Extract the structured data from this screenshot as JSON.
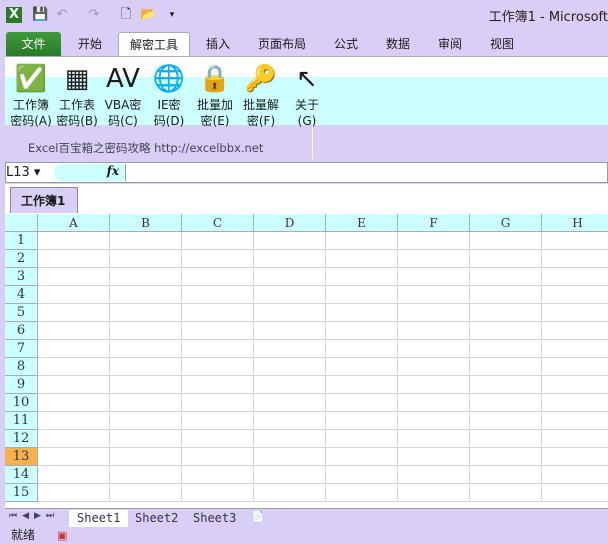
{
  "window": {
    "title": "工作簿1 - Microsoft"
  },
  "quick_access": [
    "excel-icon",
    "save-icon",
    "undo-icon",
    "redo-icon",
    "new-icon",
    "open-icon",
    "customize-icon"
  ],
  "tabs": [
    {
      "label": "文件"
    },
    {
      "label": "开始"
    },
    {
      "label": "解密工具"
    },
    {
      "label": "插入"
    },
    {
      "label": "页面布局"
    },
    {
      "label": "公式"
    },
    {
      "label": "数据"
    },
    {
      "label": "审阅"
    },
    {
      "label": "视图"
    }
  ],
  "ribbon": {
    "buttons": [
      {
        "line1": "工作簿",
        "line2": "密码(A)",
        "icon": "✅"
      },
      {
        "line1": "工作表",
        "line2": "密码(B)",
        "icon": "▦"
      },
      {
        "line1": "VBA密",
        "line2": "码(C)",
        "icon": "AV"
      },
      {
        "line1": "IE密",
        "line2": "码(D)",
        "icon": "🌐"
      },
      {
        "line1": "批量加",
        "line2": "密(E)",
        "icon": "🔒"
      },
      {
        "line1": "批量解",
        "line2": "密(F)",
        "icon": "🔑"
      },
      {
        "line1": "关于",
        "line2": "(G)",
        "icon": "↖"
      }
    ],
    "group_label": "Excel百宝箱之密码攻略  http://excelbbx.net"
  },
  "formula_bar": {
    "name_box": "L13",
    "fx": "fx",
    "value": ""
  },
  "workbook_tab": "工作簿1",
  "columns": [
    "A",
    "B",
    "C",
    "D",
    "E",
    "F",
    "G",
    "H"
  ],
  "rows": [
    "1",
    "2",
    "3",
    "4",
    "5",
    "6",
    "7",
    "8",
    "9",
    "10",
    "11",
    "12",
    "13",
    "14",
    "15"
  ],
  "selected_row": "13",
  "sheets": [
    "Sheet1",
    "Sheet2",
    "Sheet3"
  ],
  "active_sheet": "Sheet1",
  "status": {
    "text": "就绪"
  }
}
